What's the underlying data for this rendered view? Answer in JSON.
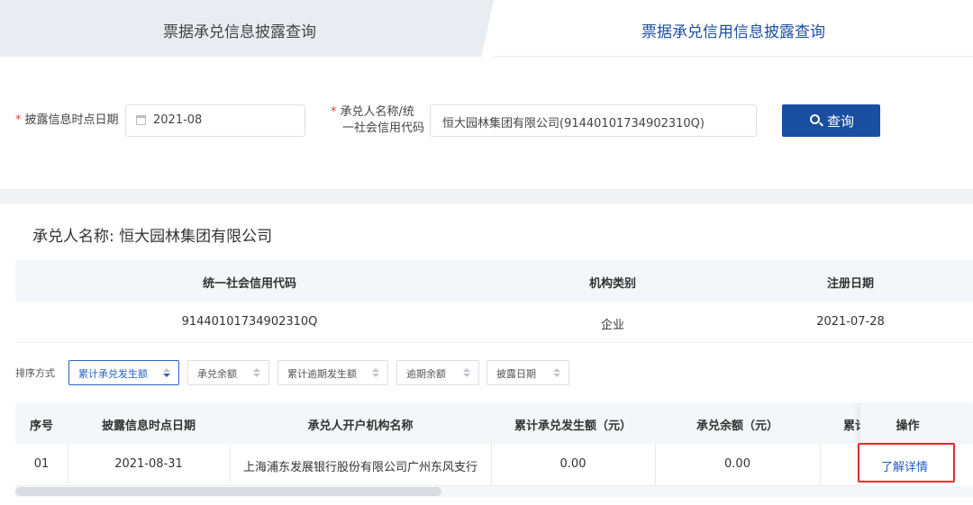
{
  "tabs": [
    {
      "label": "票据承兑信息披露查询",
      "active": false
    },
    {
      "label": "票据承兑信用信息披露查询",
      "active": true
    }
  ],
  "filters": {
    "date_label": "披露信息时点日期",
    "date_value": "2021-08",
    "name_label_line1": "承兑人名称/统",
    "name_label_line2": "一社会信用代码",
    "name_value": "恒大园林集团有限公司(91440101734902310Q)",
    "required_mark": "*",
    "query_button": "查询"
  },
  "acceptor": {
    "title_prefix": "承兑人名称:",
    "name": "恒大园林集团有限公司"
  },
  "info_table": {
    "headers": [
      "统一社会信用代码",
      "机构类别",
      "注册日期"
    ],
    "row": [
      "91440101734902310Q",
      "企业",
      "2021-07-28"
    ]
  },
  "sort": {
    "label": "排序方式",
    "options": [
      "累计承兑发生额",
      "承兑余额",
      "累计逾期发生额",
      "逾期余额",
      "披露日期"
    ],
    "active_index": 0
  },
  "main_table": {
    "headers": [
      "序号",
      "披露信息时点日期",
      "承兑人开户机构名称",
      "累计承兑发生额（元）",
      "承兑余额（元）",
      "累计"
    ],
    "action_header": "操作",
    "rows": [
      {
        "index": "01",
        "date": "2021-08-31",
        "institution": "上海浦东发展银行股份有限公司广州东风支行",
        "cumulative": "0.00",
        "balance": "0.00",
        "action": "了解详情"
      }
    ]
  },
  "colors": {
    "accent": "#1a4ea0",
    "link": "#1f5fc4",
    "highlight": "#e0302b"
  }
}
